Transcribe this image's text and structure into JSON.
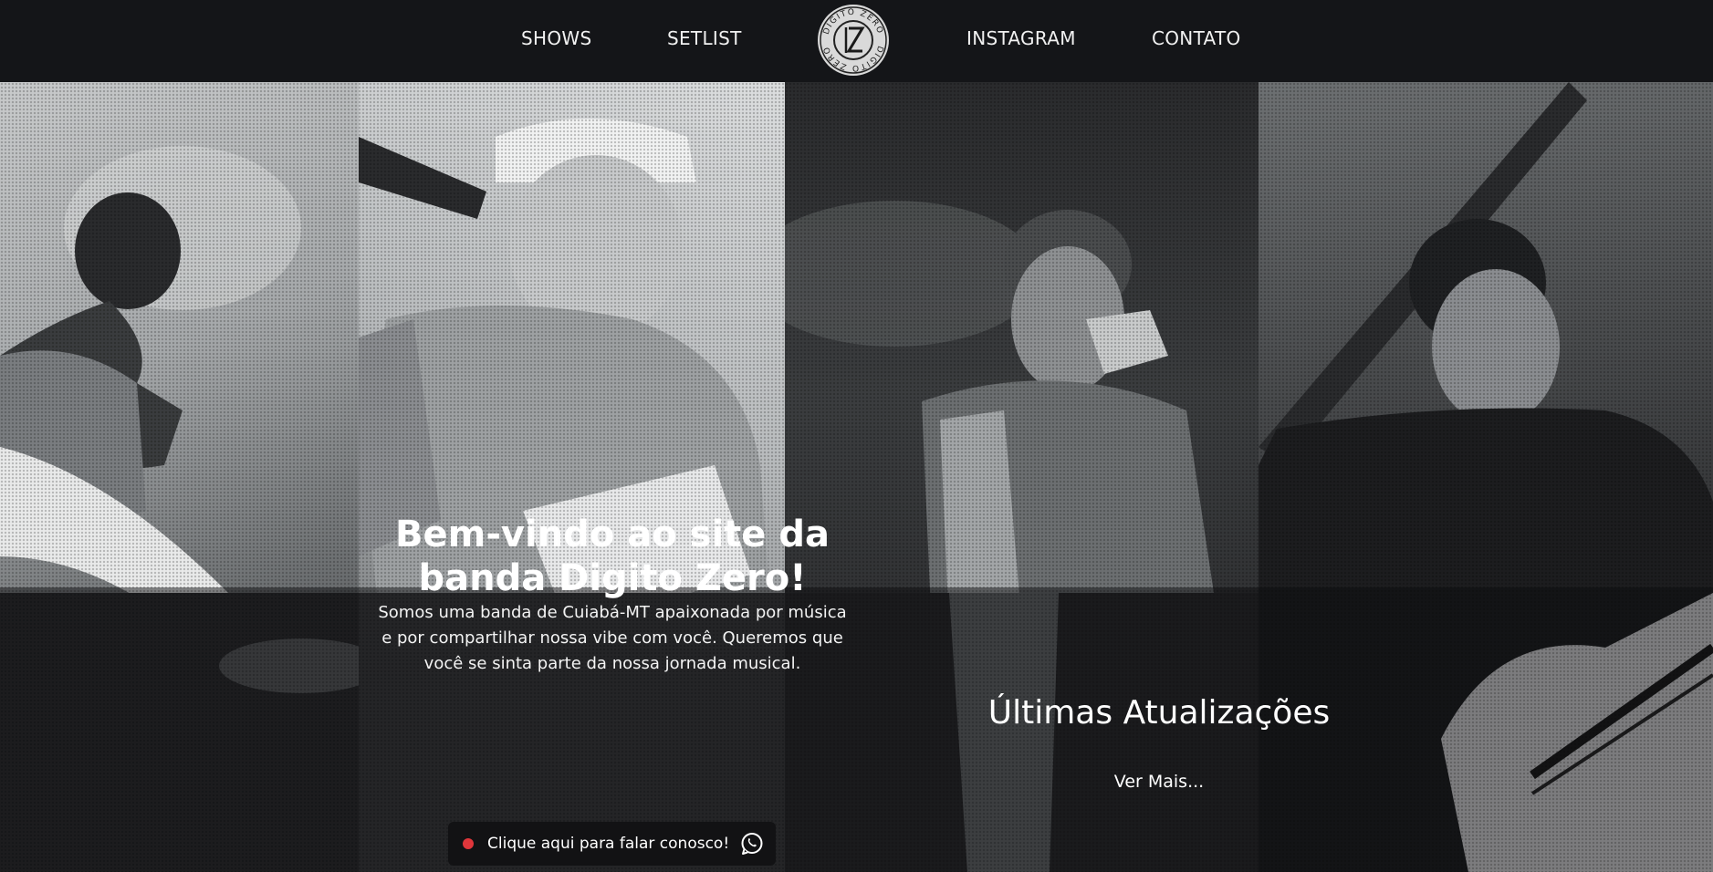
{
  "nav": {
    "links": [
      "SHOWS",
      "SETLIST",
      "INSTAGRAM",
      "CONTATO"
    ],
    "logo": {
      "ring_text": "DIGITO ZERO",
      "monogram": "DZ",
      "icon": "band-logo-icon"
    }
  },
  "hero": {
    "title": "Bem-vindo ao site da banda Digito Zero!",
    "text": "Somos uma banda de Cuiabá-MT apaixonada por música e por compartilhar nossa vibe com você. Queremos que você se sinta parte da nossa jornada musical.",
    "contact_button": {
      "label": "Clique aqui para falar conosco!",
      "status_color": "#e0363b",
      "icon": "whatsapp-icon"
    }
  },
  "updates": {
    "title": "Últimas Atualizações",
    "link": "Ver Mais..."
  },
  "colors": {
    "background": "#141518",
    "text": "#ffffff",
    "accent_dot": "#e0363b"
  }
}
